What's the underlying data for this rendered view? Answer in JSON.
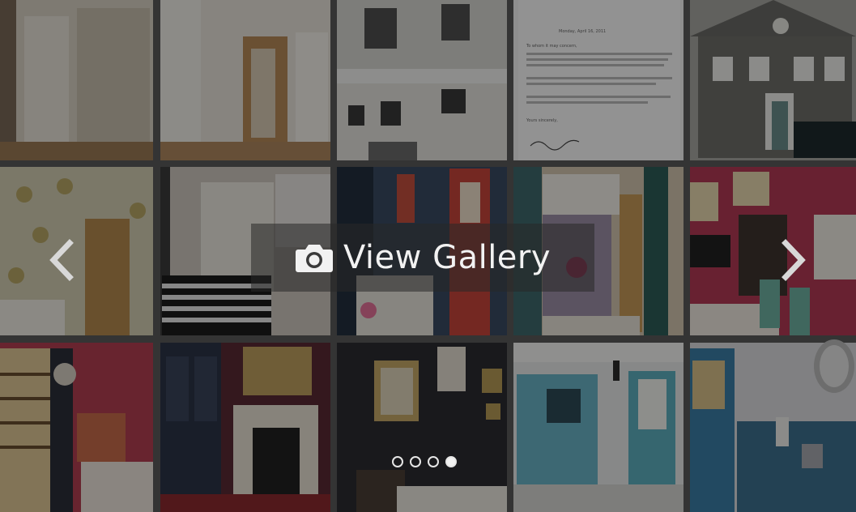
{
  "gallery": {
    "button_label": "View Gallery",
    "camera_icon": "camera-icon",
    "prev_icon": "chevron-left-icon",
    "next_icon": "chevron-right-icon",
    "total_slides": 4,
    "active_slide": 4
  },
  "letter_text": {
    "date": "Monday, April 16, 2011",
    "salutation": "To whom it may concern,",
    "closing": "Yours sincerely,"
  }
}
